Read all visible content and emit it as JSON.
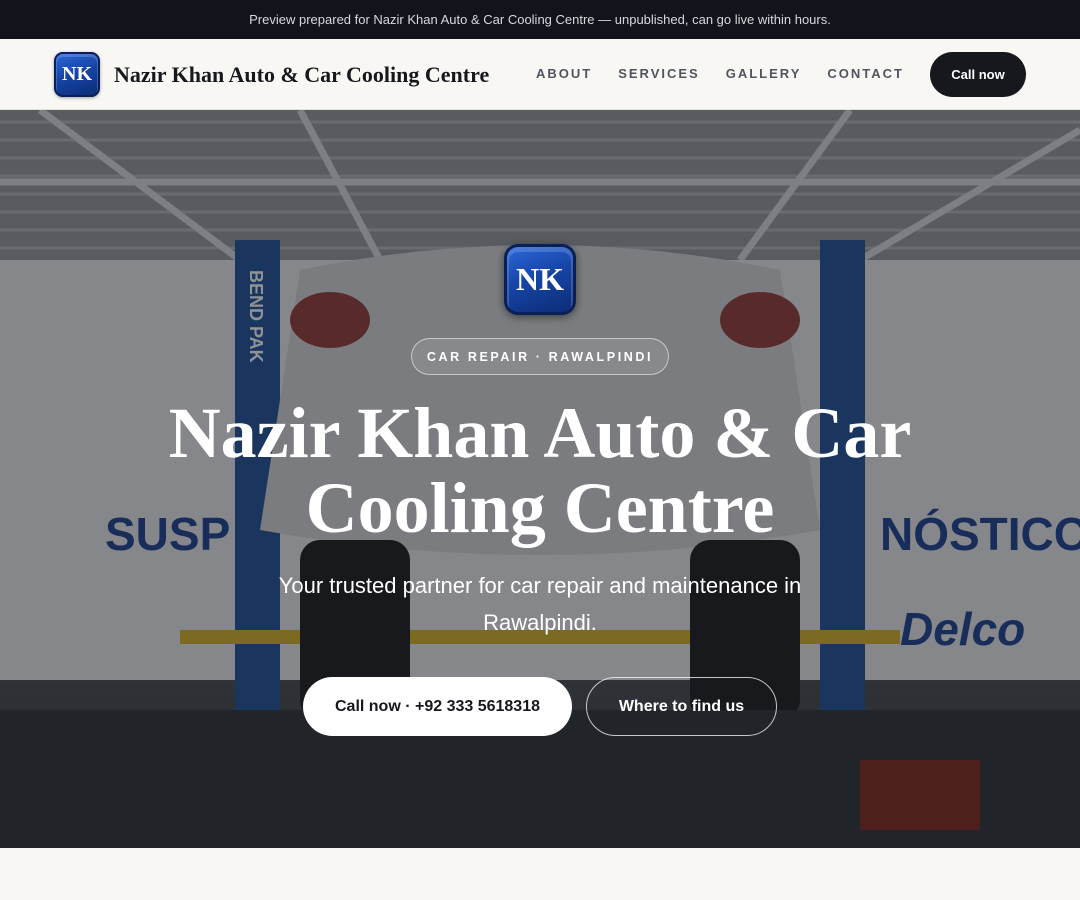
{
  "preview_bar": {
    "text": "Preview prepared for Nazir Khan Auto & Car Cooling Centre — unpublished, can go live within hours."
  },
  "header": {
    "logo_initials": "NK",
    "brand_name": "Nazir Khan Auto & Car Cooling Centre",
    "nav": [
      {
        "label": "ABOUT"
      },
      {
        "label": "SERVICES"
      },
      {
        "label": "GALLERY"
      },
      {
        "label": "CONTACT"
      }
    ],
    "cta_label": "Call now"
  },
  "hero": {
    "badge_initials": "NK",
    "tag": "CAR REPAIR · RAWALPINDI",
    "title": "Nazir Khan Auto & Car Cooling Centre",
    "subtitle": "Your trusted partner for car repair and maintenance in Rawalpindi.",
    "primary_button": "Call now · +92 333 5618318",
    "secondary_button": "Where to find us",
    "background_signage": {
      "left": "SUSP",
      "right": "NÓSTICO",
      "right_lower": "Delco",
      "lift_brand": "BEND PAK"
    }
  },
  "colors": {
    "preview_bar_bg": "#11141a",
    "brand_blue": "#1746a8",
    "dark": "#16181d",
    "page_bg": "#f8f7f4"
  }
}
